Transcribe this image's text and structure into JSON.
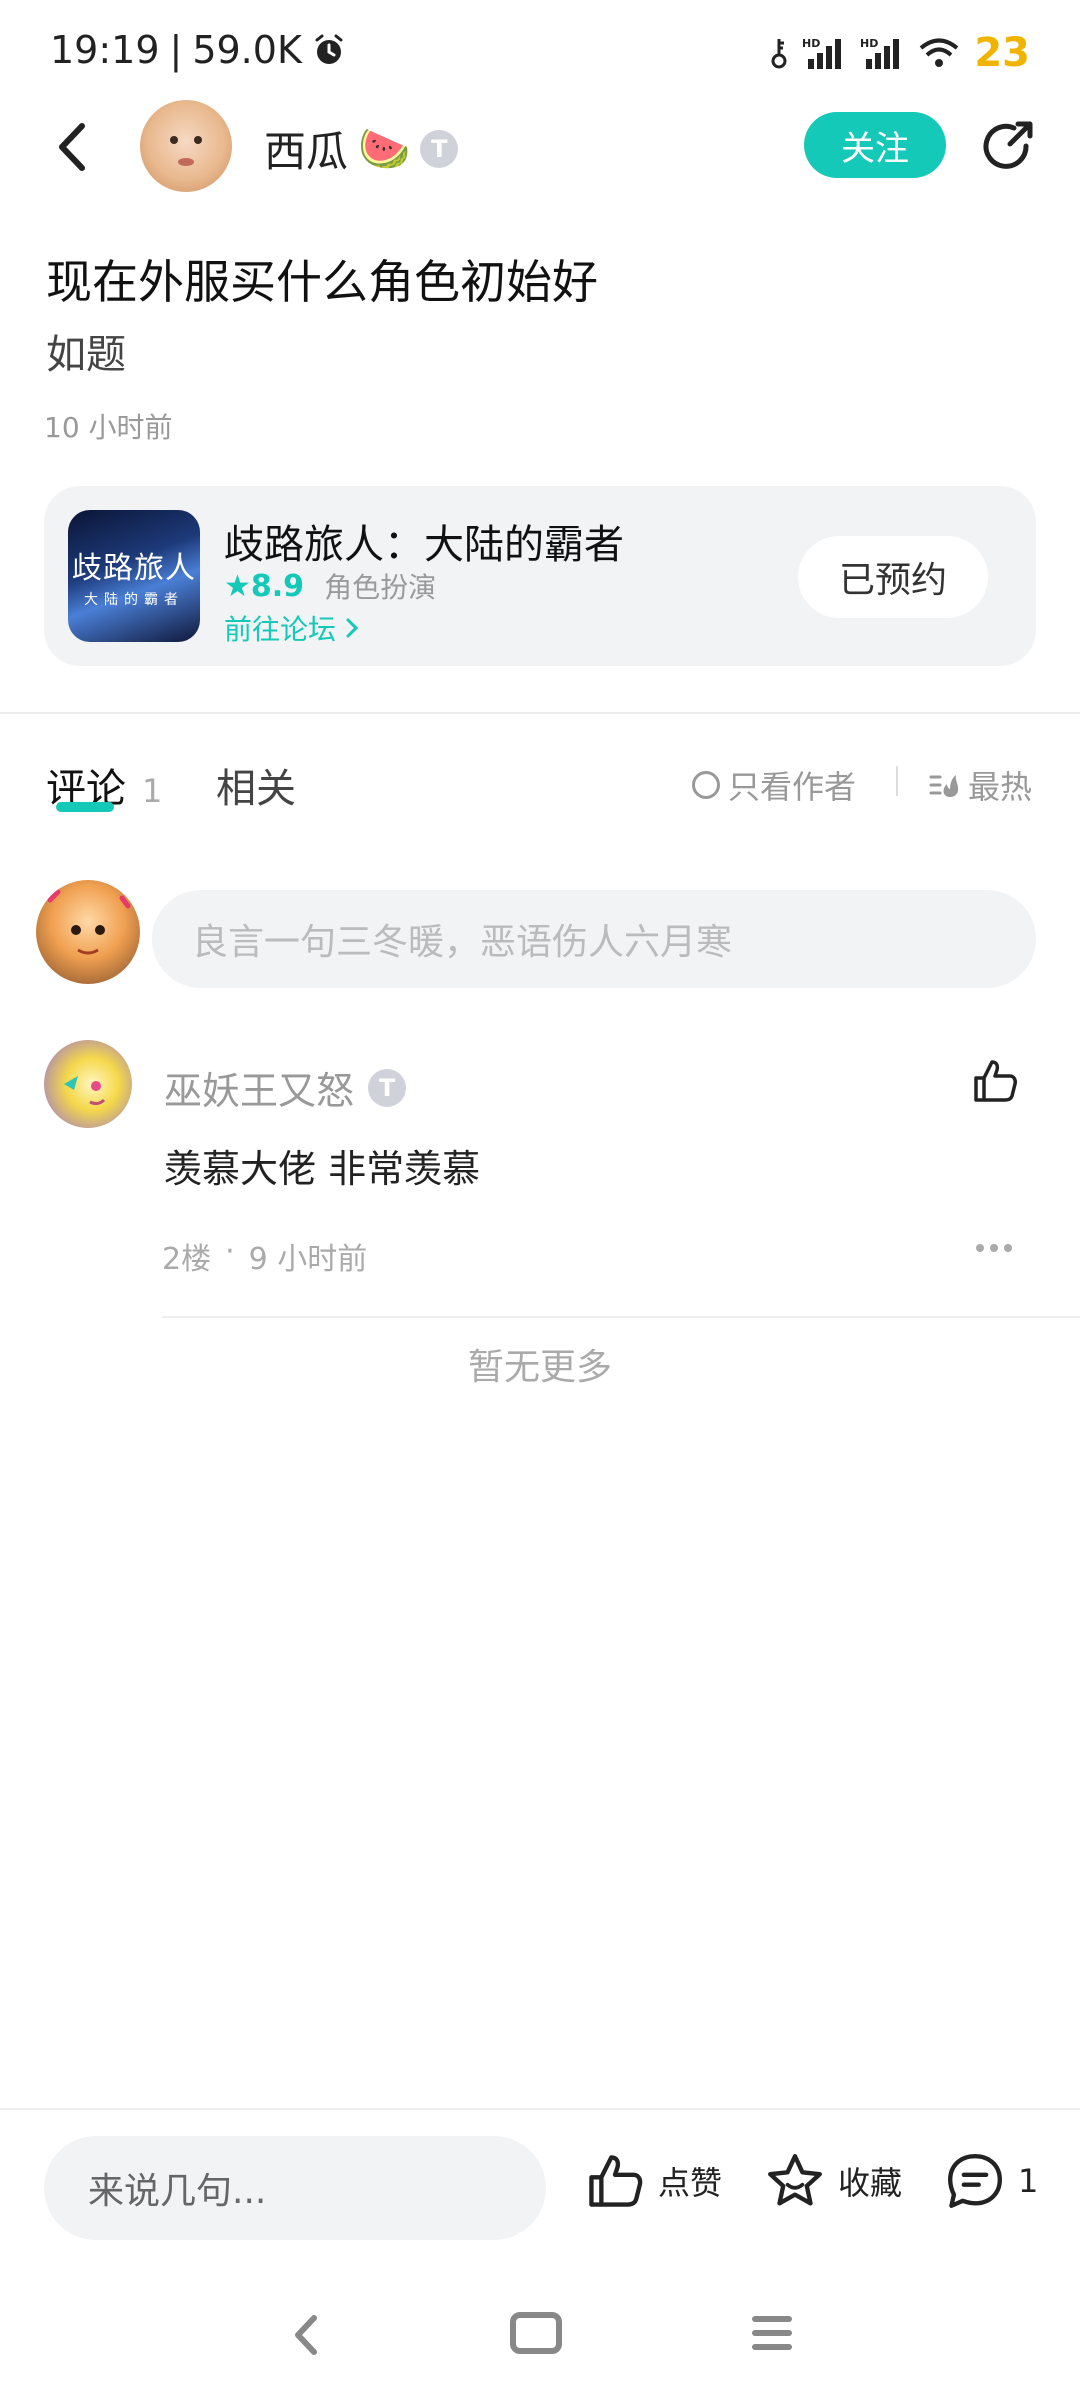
{
  "status_bar": {
    "time": "19:19",
    "speed": "59.0K",
    "battery": "23",
    "icons": [
      "alarm-icon",
      "key-icon",
      "signal-hd-icon",
      "signal-hd-icon",
      "wifi-icon"
    ]
  },
  "header": {
    "username": "西瓜",
    "user_emoji": "🍉",
    "user_level": "T",
    "follow_label": "关注"
  },
  "post": {
    "title": "现在外服买什么角色初始好",
    "body": "如题",
    "time": "10 小时前"
  },
  "game_card": {
    "name": "歧路旅人：大陆的霸者",
    "icon_title": "歧路旅人",
    "icon_subtitle": "大陆的霸者",
    "rating": "8.9",
    "genre": "角色扮演",
    "forum_link": "前往论坛",
    "reserve_label": "已预约"
  },
  "tabs": {
    "comments_label": "评论",
    "comments_count": "1",
    "related_label": "相关",
    "author_only_label": "只看作者",
    "sort_label": "最热"
  },
  "comment_input": {
    "placeholder": "良言一句三冬暖，恶语伤人六月寒"
  },
  "comments": [
    {
      "user": "巫妖王又怒",
      "level": "T",
      "text": "羡慕大佬 非常羡慕",
      "floor": "2楼",
      "time": "9 小时前"
    }
  ],
  "no_more": "暂无更多",
  "bottom_bar": {
    "say_placeholder": "来说几句...",
    "like_label": "点赞",
    "fav_label": "收藏",
    "comment_count": "1"
  },
  "colors": {
    "accent": "#14c9b7",
    "battery": "#f0b400"
  }
}
